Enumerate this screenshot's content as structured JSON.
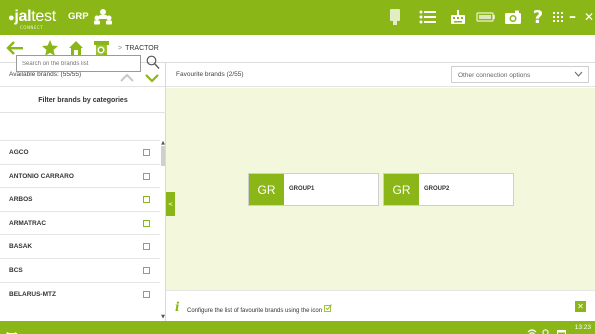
{
  "topbar": {
    "logo": {
      "brand_prefix": "jal",
      "brand_suffix": "test",
      "tagline": "CONNECT"
    },
    "group_label": "GRP",
    "icons": [
      "cable-icon",
      "list-icon",
      "keyboard-icon",
      "battery-icon",
      "camera-icon",
      "help-icon",
      "apps-grid-icon"
    ],
    "window_controls": {
      "minimize": "–",
      "maximize": "□",
      "close": "✕"
    }
  },
  "navbar": {
    "icons": [
      "back-arrow-icon",
      "star-icon",
      "home-icon",
      "search-tractor-icon"
    ],
    "breadcrumb": "TRACTOR"
  },
  "left_panel": {
    "title": "Available brands: (55/55)",
    "filter_label": "Filter brands by categories",
    "search_placeholder": "Search on the brands list",
    "brands": [
      "AGCO",
      "ANTONIO CARRARO",
      "ARBOS",
      "ARMATRAC",
      "BASAK",
      "BCS",
      "BELARUS-MTZ"
    ]
  },
  "right_panel": {
    "title": "Favourite brands (2/55)",
    "select_value": "Other connection options",
    "groups": [
      {
        "badge": "GR",
        "name": "GROUP1"
      },
      {
        "badge": "GR",
        "name": "GROUP2"
      }
    ],
    "info_text": "Configure the list of favourite brands using the icon"
  },
  "statusbar": {
    "time": "13:23"
  },
  "colors": {
    "accent": "#8ab617",
    "workarea": "#f3f7db"
  }
}
